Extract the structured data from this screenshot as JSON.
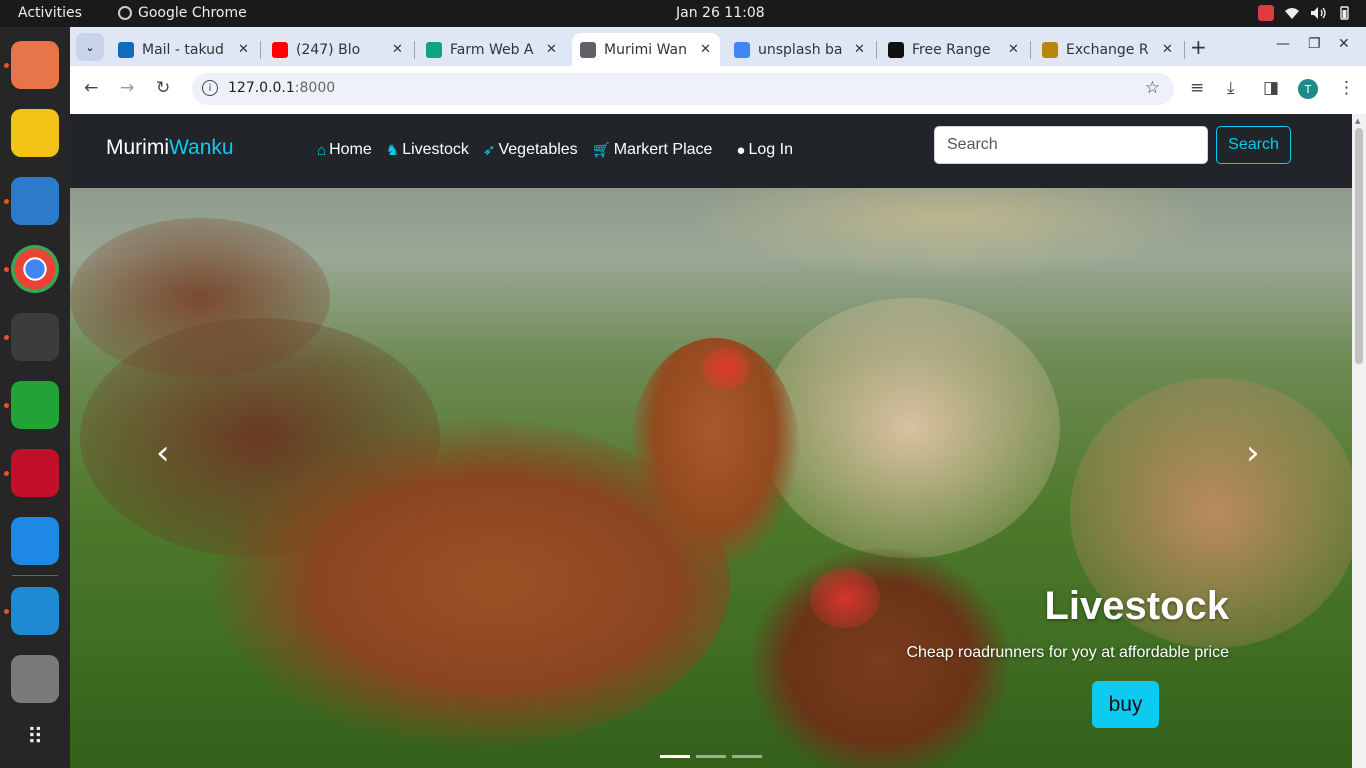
{
  "system": {
    "activities": "Activities",
    "app_name": "Google Chrome",
    "clock": "Jan 26  11:08"
  },
  "dock": {
    "items": [
      {
        "name": "files-icon",
        "color": "#e8744a"
      },
      {
        "name": "rhythmbox-icon",
        "color": "#f2c316"
      },
      {
        "name": "writer-icon",
        "color": "#2c7bcb"
      },
      {
        "name": "chrome-icon",
        "color": "#4285f4"
      },
      {
        "name": "terminal-icon",
        "color": "#3c3c3c"
      },
      {
        "name": "calc-icon",
        "color": "#21a336"
      },
      {
        "name": "cherry-icon",
        "color": "#c2102a"
      },
      {
        "name": "webstorm-icon",
        "color": "#1e88e5"
      },
      {
        "name": "vscode-icon",
        "color": "#1f8ad2"
      },
      {
        "name": "trash-icon",
        "color": "#7a7a7a"
      }
    ]
  },
  "browser": {
    "tabs": [
      {
        "title": "Mail - takud",
        "icon": "outlook-icon",
        "color": "#0f6cbd"
      },
      {
        "title": "(247) Blo",
        "icon": "youtube-icon",
        "color": "#ff0000"
      },
      {
        "title": "Farm Web A",
        "icon": "chatgpt-icon",
        "color": "#10a37f"
      },
      {
        "title": "Murimi Wan",
        "icon": "globe-icon",
        "color": "#5f6368"
      },
      {
        "title": "unsplash ba",
        "icon": "google-icon",
        "color": "#4285f4"
      },
      {
        "title": "Free Range",
        "icon": "unsplash-icon",
        "color": "#111111"
      },
      {
        "title": "Exchange R",
        "icon": "exchange-icon",
        "color": "#b8860b"
      }
    ],
    "address": "127.0.0.1",
    "port": ":8000",
    "avatar": "T"
  },
  "site": {
    "brand_part1": "Murimi",
    "brand_part2": "Wanku",
    "nav": {
      "home": "Home",
      "livestock": "Livestock",
      "vegetables": "Vegetables",
      "marketplace": "Markert Place",
      "login": "Log In"
    },
    "search_placeholder": "Search",
    "search_button": "Search"
  },
  "hero": {
    "title": "Livestock",
    "text": "Cheap roadrunners for yoy at affordable price",
    "button": "buy",
    "prev": "‹",
    "next": "›",
    "active_slide": 1,
    "slide_count": 3
  },
  "colors": {
    "accent": "#0dcaf0",
    "navbar": "#212529",
    "tabstrip": "#dfe6f4"
  }
}
